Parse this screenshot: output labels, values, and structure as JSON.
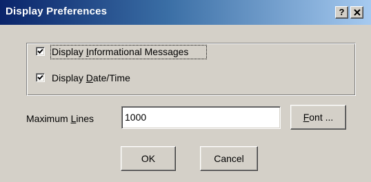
{
  "window": {
    "title": "Display Preferences",
    "help_button": "?",
    "close_icon": "close-icon"
  },
  "options": {
    "informational": {
      "label_pre": "Display ",
      "label_mnemonic": "I",
      "label_post": "nformational Messages",
      "checked": true
    },
    "datetime": {
      "label_pre": "Display ",
      "label_mnemonic": "D",
      "label_post": "ate/Time",
      "checked": true
    }
  },
  "max_lines": {
    "label_pre": "Maximum ",
    "label_mnemonic": "L",
    "label_post": "ines",
    "value": "1000"
  },
  "buttons": {
    "font_mnemonic": "F",
    "font_rest": "ont ...",
    "ok": "OK",
    "cancel": "Cancel"
  }
}
